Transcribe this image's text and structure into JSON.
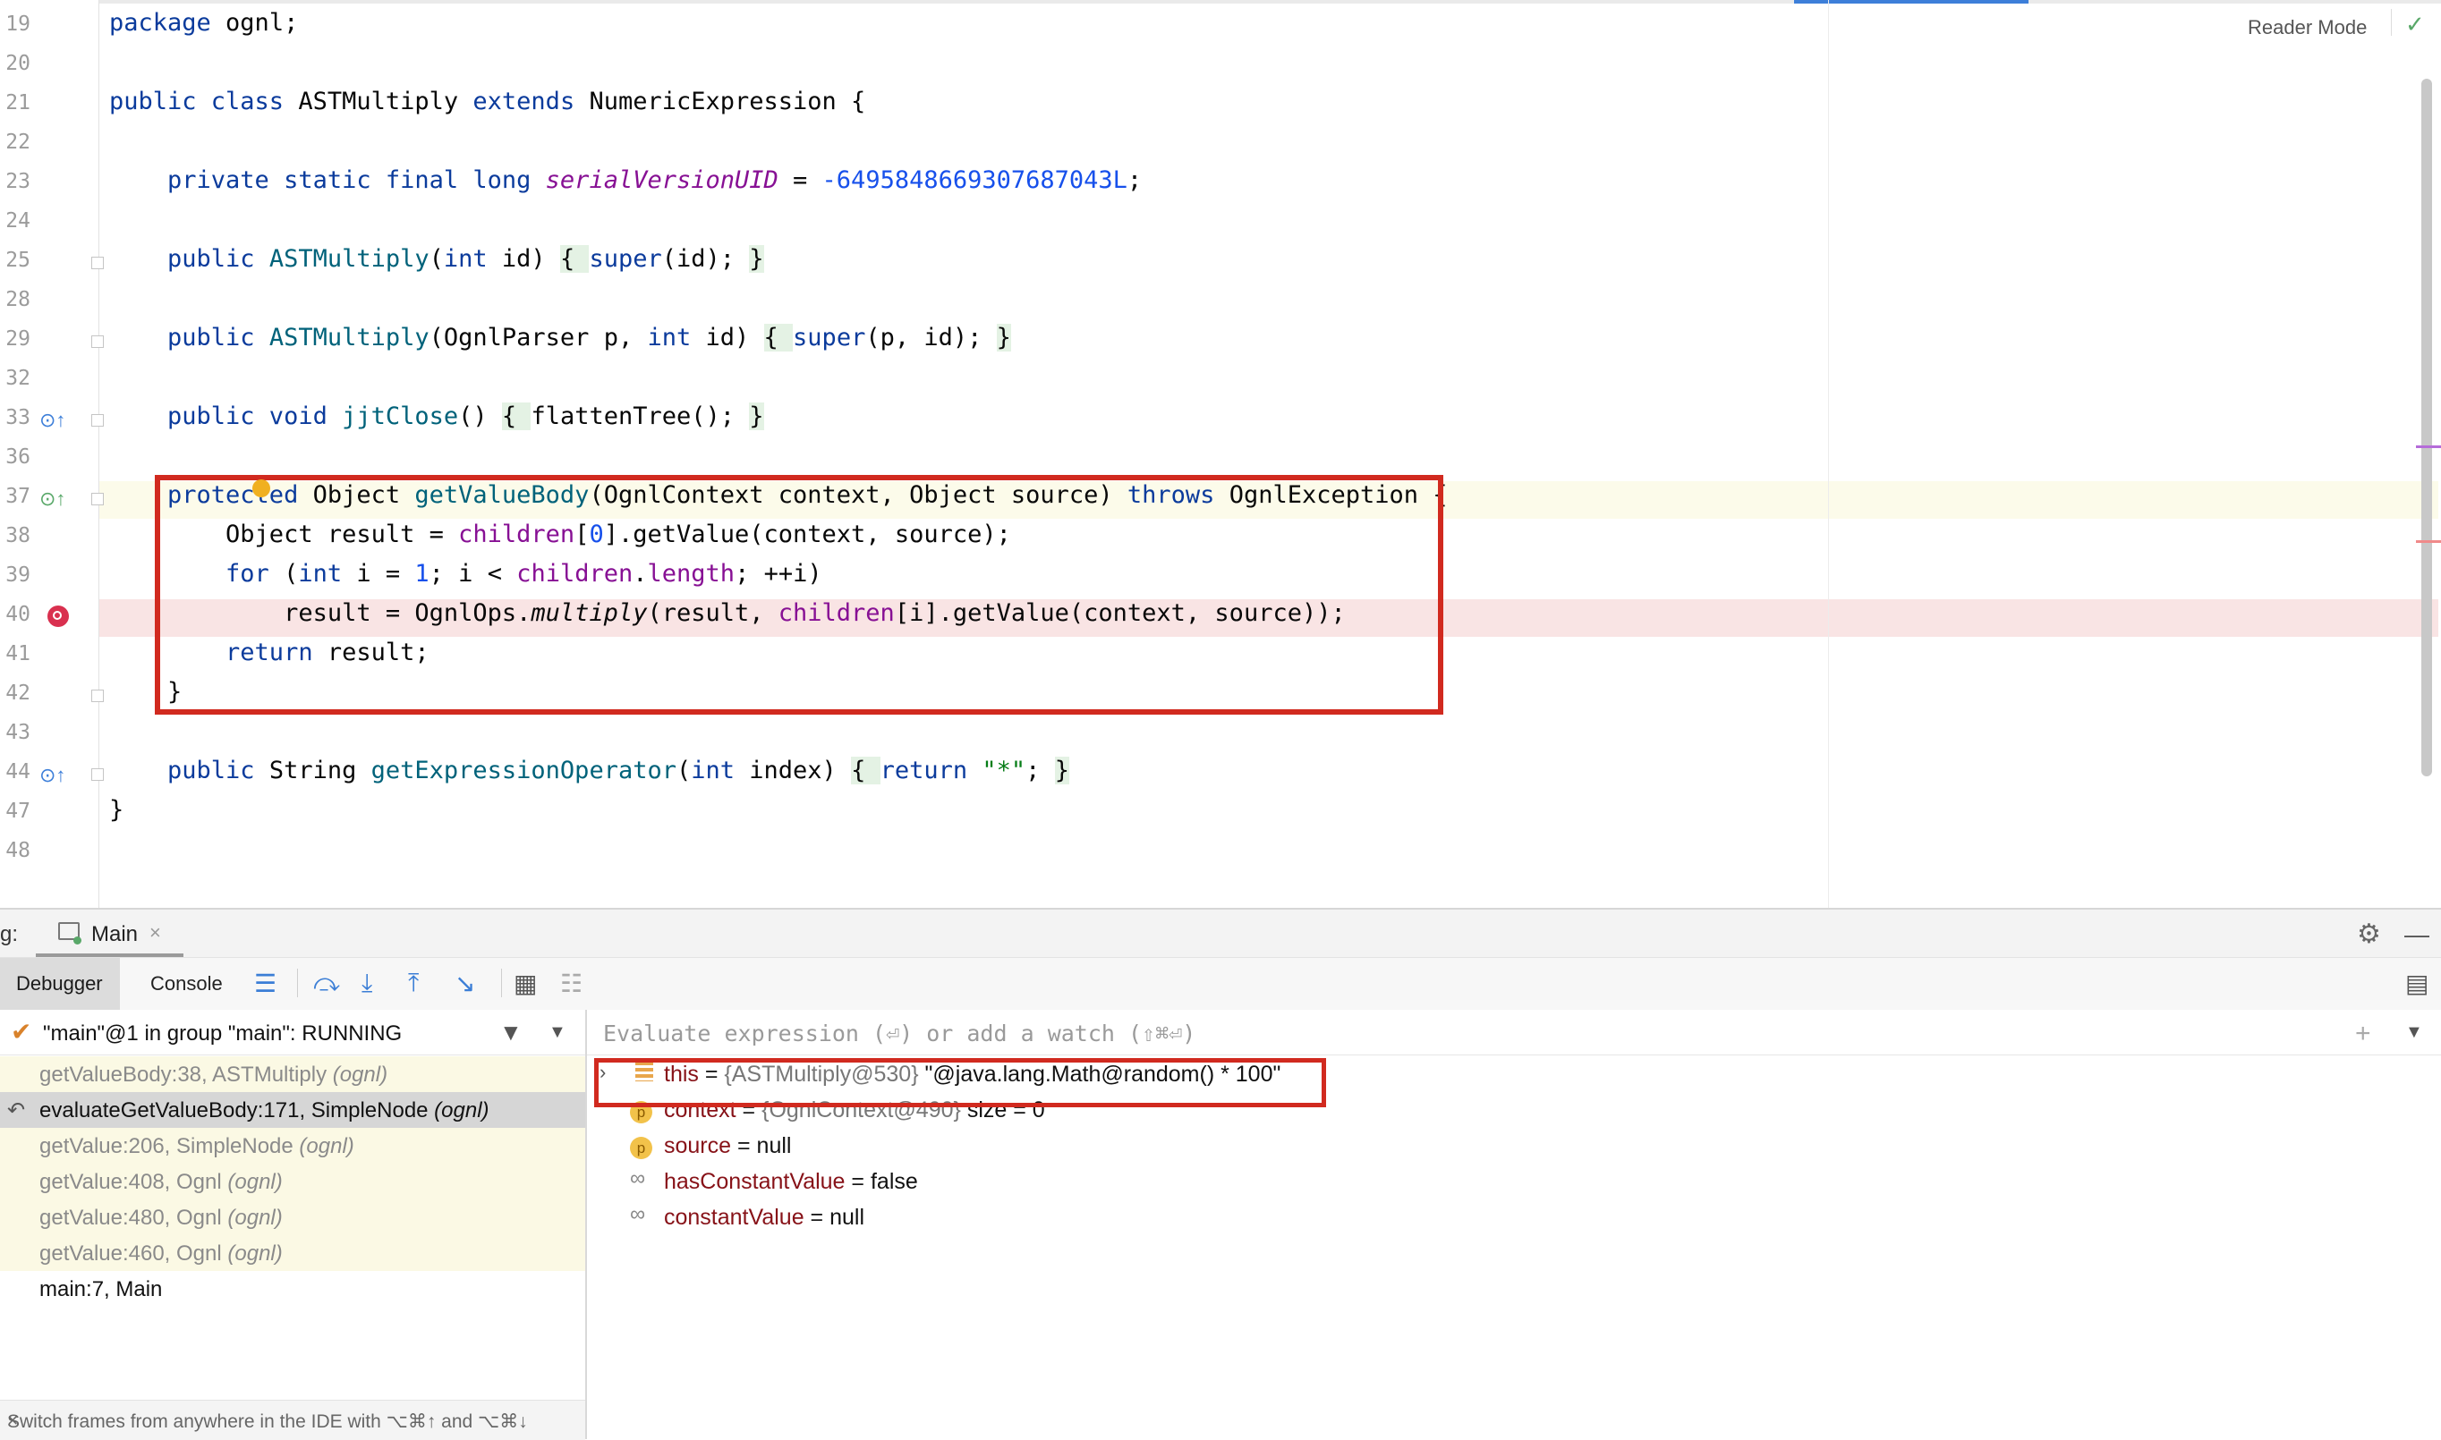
{
  "editor": {
    "reader_mode": "Reader Mode",
    "lines": [
      {
        "n": "19",
        "tokens": [
          {
            "t": "package ",
            "c": "kw"
          },
          {
            "t": "ognl;"
          }
        ]
      },
      {
        "n": "20",
        "tokens": []
      },
      {
        "n": "21",
        "tokens": [
          {
            "t": "public class ",
            "c": "kw"
          },
          {
            "t": "ASTMultiply "
          },
          {
            "t": "extends ",
            "c": "kw"
          },
          {
            "t": "NumericExpression {"
          }
        ]
      },
      {
        "n": "22",
        "tokens": []
      },
      {
        "n": "23",
        "tokens": [
          {
            "t": "    private static final long ",
            "c": "kw"
          },
          {
            "t": "serialVersionUID",
            "c": "fld it"
          },
          {
            "t": " = "
          },
          {
            "t": "-6495848669307687043L",
            "c": "num"
          },
          {
            "t": ";"
          }
        ]
      },
      {
        "n": "24",
        "tokens": []
      },
      {
        "n": "25",
        "tokens": [
          {
            "t": "    public ",
            "c": "kw"
          },
          {
            "t": "ASTMultiply",
            "c": "fn"
          },
          {
            "t": "("
          },
          {
            "t": "int ",
            "c": "kw"
          },
          {
            "t": "id) "
          },
          {
            "t": "{ ",
            "c": "curly"
          },
          {
            "t": "super",
            "c": "kw"
          },
          {
            "t": "(id); "
          },
          {
            "t": "}",
            "c": "curly"
          }
        ]
      },
      {
        "n": "28",
        "tokens": []
      },
      {
        "n": "29",
        "tokens": [
          {
            "t": "    public ",
            "c": "kw"
          },
          {
            "t": "ASTMultiply",
            "c": "fn"
          },
          {
            "t": "(OgnlParser p, "
          },
          {
            "t": "int ",
            "c": "kw"
          },
          {
            "t": "id) "
          },
          {
            "t": "{ ",
            "c": "curly"
          },
          {
            "t": "super",
            "c": "kw"
          },
          {
            "t": "(p, id); "
          },
          {
            "t": "}",
            "c": "curly"
          }
        ]
      },
      {
        "n": "32",
        "tokens": []
      },
      {
        "n": "33",
        "tokens": [
          {
            "t": "    public void ",
            "c": "kw"
          },
          {
            "t": "jjtClose",
            "c": "fn"
          },
          {
            "t": "() "
          },
          {
            "t": "{ ",
            "c": "curly"
          },
          {
            "t": "flattenTree(); "
          },
          {
            "t": "}",
            "c": "curly"
          }
        ]
      },
      {
        "n": "36",
        "tokens": []
      },
      {
        "n": "37",
        "tokens": [
          {
            "t": "    protected ",
            "c": "kw"
          },
          {
            "t": "Object "
          },
          {
            "t": "getValueBody",
            "c": "fn"
          },
          {
            "t": "(OgnlContext context, Object source) "
          },
          {
            "t": "throws ",
            "c": "kw"
          },
          {
            "t": "OgnlException {"
          }
        ]
      },
      {
        "n": "38",
        "tokens": [
          {
            "t": "        Object result = "
          },
          {
            "t": "children",
            "c": "fld"
          },
          {
            "t": "["
          },
          {
            "t": "0",
            "c": "num"
          },
          {
            "t": "].getValue(context, source);"
          }
        ]
      },
      {
        "n": "39",
        "tokens": [
          {
            "t": "        for ",
            "c": "kw"
          },
          {
            "t": "("
          },
          {
            "t": "int ",
            "c": "kw"
          },
          {
            "t": "i = "
          },
          {
            "t": "1",
            "c": "num"
          },
          {
            "t": "; i < "
          },
          {
            "t": "children",
            "c": "fld"
          },
          {
            "t": "."
          },
          {
            "t": "length",
            "c": "fld"
          },
          {
            "t": "; ++i)"
          }
        ]
      },
      {
        "n": "40",
        "tokens": [
          {
            "t": "            result = OgnlOps."
          },
          {
            "t": "multiply",
            "c": "it"
          },
          {
            "t": "(result, "
          },
          {
            "t": "children",
            "c": "fld"
          },
          {
            "t": "[i].getValue(context, source));"
          }
        ]
      },
      {
        "n": "41",
        "tokens": [
          {
            "t": "        return ",
            "c": "kw"
          },
          {
            "t": "result;"
          }
        ]
      },
      {
        "n": "42",
        "tokens": [
          {
            "t": "    }"
          }
        ]
      },
      {
        "n": "43",
        "tokens": []
      },
      {
        "n": "44",
        "tokens": [
          {
            "t": "    public ",
            "c": "kw"
          },
          {
            "t": "String "
          },
          {
            "t": "getExpressionOperator",
            "c": "fn"
          },
          {
            "t": "("
          },
          {
            "t": "int ",
            "c": "kw"
          },
          {
            "t": "index) "
          },
          {
            "t": "{ ",
            "c": "curly"
          },
          {
            "t": "return ",
            "c": "kw"
          },
          {
            "t": "\"*\"",
            "c": "str"
          },
          {
            "t": "; "
          },
          {
            "t": "}",
            "c": "curly"
          }
        ]
      },
      {
        "n": "47",
        "tokens": [
          {
            "t": "}"
          }
        ]
      },
      {
        "n": "48",
        "tokens": []
      }
    ]
  },
  "debug": {
    "label": "g:",
    "session_tab": "Main",
    "tabs": {
      "debugger": "Debugger",
      "console": "Console"
    },
    "thread": "\"main\"@1 in group \"main\": RUNNING",
    "frames": [
      {
        "method": "getValueBody:38, ASTMultiply",
        "pkg": "(ognl)",
        "kind": "lib"
      },
      {
        "method": "evaluateGetValueBody:171, SimpleNode",
        "pkg": "(ognl)",
        "kind": "sel"
      },
      {
        "method": "getValue:206, SimpleNode",
        "pkg": "(ognl)",
        "kind": "lib"
      },
      {
        "method": "getValue:408, Ognl",
        "pkg": "(ognl)",
        "kind": "lib"
      },
      {
        "method": "getValue:480, Ognl",
        "pkg": "(ognl)",
        "kind": "lib"
      },
      {
        "method": "getValue:460, Ognl",
        "pkg": "(ognl)",
        "kind": "lib"
      },
      {
        "method": "main:7, Main",
        "pkg": "",
        "kind": "user"
      }
    ],
    "hint": "Switch frames from anywhere in the IDE with ⌥⌘↑ and ⌥⌘↓",
    "eval_placeholder": "Evaluate expression (⏎) or add a watch (⇧⌘⏎)",
    "variables": [
      {
        "name": "this",
        "type": "{ASTMultiply@530}",
        "value": "\"@java.lang.Math@random() * 100\"",
        "icon": "field",
        "expandable": true
      },
      {
        "name": "context",
        "type": "{OgnlContext@490}",
        "value": "size = 0",
        "icon": "param",
        "expandable": false
      },
      {
        "name": "source",
        "type": "",
        "value": "null",
        "icon": "param",
        "expandable": false
      },
      {
        "name": "hasConstantValue",
        "type": "",
        "value": "false",
        "icon": "glasses",
        "expandable": false
      },
      {
        "name": "constantValue",
        "type": "",
        "value": "null",
        "icon": "glasses",
        "expandable": false
      }
    ]
  },
  "colors": {
    "annotation_box": "#d12a1f",
    "breakpoint": "#d9304f",
    "accent": "#3d7fd9"
  }
}
